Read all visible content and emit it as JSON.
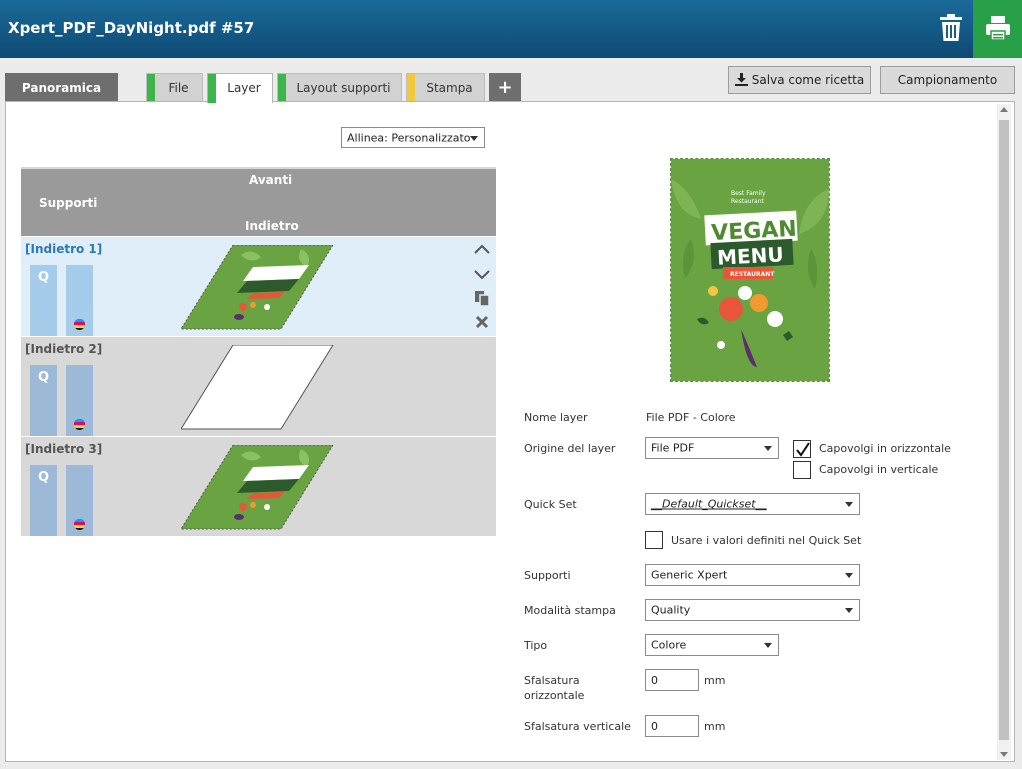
{
  "window": {
    "title": "Xpert_PDF_DayNight.pdf #57"
  },
  "colors": {
    "titlebar": "#1b6a9a",
    "print_button": "#27a048",
    "tab_mark_green": "#3db54a",
    "tab_mark_yellow": "#f3c93a",
    "selected_row": "#e0eefa",
    "selected_name": "#2b7ab8"
  },
  "tabs": [
    {
      "label": "Panoramica",
      "mark": ""
    },
    {
      "label": "File",
      "mark": "green"
    },
    {
      "label": "Layer",
      "mark": "green"
    },
    {
      "label": "Layout supporti",
      "mark": "green"
    },
    {
      "label": "Stampa",
      "mark": "yellow"
    },
    {
      "label": "+",
      "mark": ""
    }
  ],
  "toolbar": {
    "save_recipe": "Salva come ricetta",
    "sampling": "Campionamento"
  },
  "align": {
    "value": "Allinea: Personalizzato"
  },
  "layers_header": {
    "front": "Avanti",
    "media": "Supporti",
    "back": "Indietro"
  },
  "layers": [
    {
      "name": "[Indietro 1]",
      "q": "Q",
      "selected": true,
      "image": "vegan-menu"
    },
    {
      "name": "[Indietro 2]",
      "q": "Q",
      "selected": false,
      "image": "blank"
    },
    {
      "name": "[Indietro 3]",
      "q": "Q",
      "selected": false,
      "image": "vegan-menu"
    }
  ],
  "preview": {
    "line1": "Best Family",
    "line2": "Restaurant",
    "title1": "VEGAN",
    "title2": "MENU",
    "badge": "RESTAURANT"
  },
  "form": {
    "layer_name_label": "Nome layer",
    "layer_name_value": "File PDF - Colore",
    "origin_label": "Origine del layer",
    "origin_value": "File PDF",
    "flip_h_label": "Capovolgi in orizzontale",
    "flip_h_checked": true,
    "flip_v_label": "Capovolgi in verticale",
    "flip_v_checked": false,
    "quickset_label": "Quick Set",
    "quickset_value": "__Default_Quickset__",
    "use_quickset_label": "Usare i valori definiti nel Quick Set",
    "use_quickset_checked": false,
    "media_label": "Supporti",
    "media_value": "Generic Xpert",
    "print_mode_label": "Modalità stampa",
    "print_mode_value": "Quality",
    "type_label": "Tipo",
    "type_value": "Colore",
    "offset_h_label1": "Sfalsatura",
    "offset_h_label2": "orizzontale",
    "offset_h_value": "0",
    "offset_h_unit": "mm",
    "offset_v_label": "Sfalsatura verticale",
    "offset_v_value": "0",
    "offset_v_unit": "mm"
  }
}
